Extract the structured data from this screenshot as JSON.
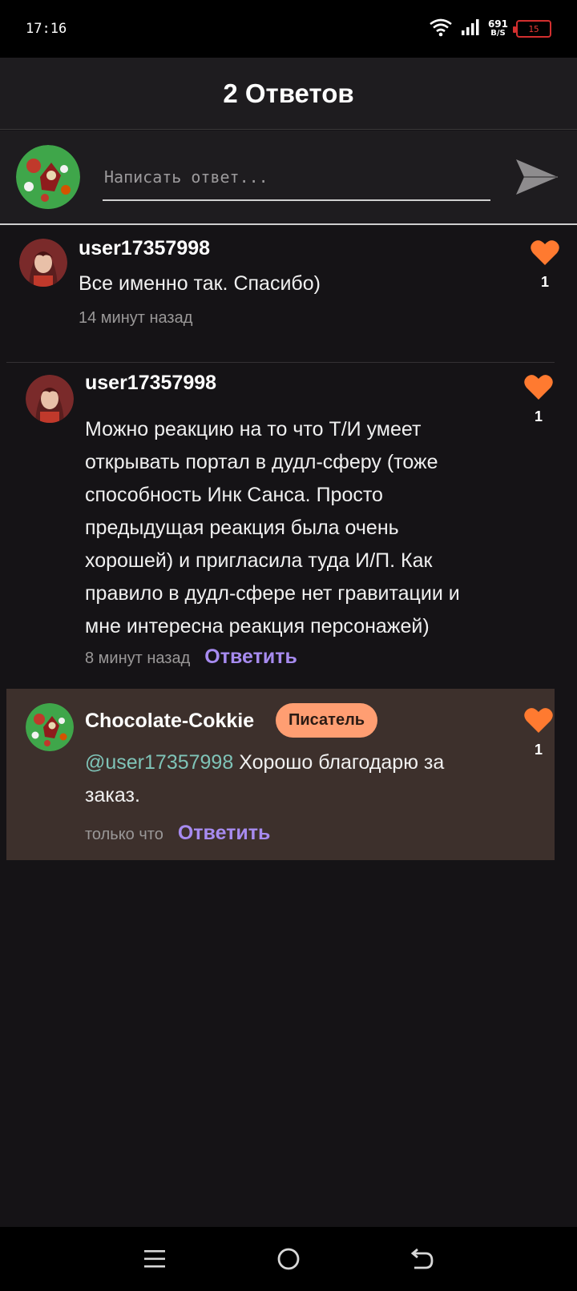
{
  "status_bar": {
    "time": "17:16",
    "net_speed_value": "691",
    "net_speed_unit": "B/S",
    "battery": "15"
  },
  "header": {
    "title": "2 Ответов"
  },
  "reply_box": {
    "placeholder": "Написать ответ..."
  },
  "comments": [
    {
      "username": "user17357998",
      "text": "Все именно так. Спасибо)",
      "time": "14 минут назад",
      "likes": "1"
    },
    {
      "username": "user17357998",
      "text": "Можно реакцию на то что Т/И умеет открывать портал в дудл-сферу (тоже способность Инк Санса. Просто предыдущая реакция была очень хорошей) и пригласила туда И/П. Как правило в дудл-сфере нет гравитации и мне интересна реакция персонажей)",
      "time": "8 минут назад",
      "reply_label": "Ответить",
      "likes": "1"
    },
    {
      "username": "Chocolate-Cokkie",
      "badge": "Писатель",
      "mention": "@user17357998",
      "text": " Хорошо благодарю за заказ.",
      "time": "только что",
      "reply_label": "Ответить",
      "likes": "1"
    }
  ],
  "colors": {
    "accent_heart": "#ff7a30",
    "reply_link": "#a78bf0",
    "badge_bg": "#ff9e72",
    "highlight_bg": "#3d302c",
    "mention": "#7fc4b8"
  }
}
